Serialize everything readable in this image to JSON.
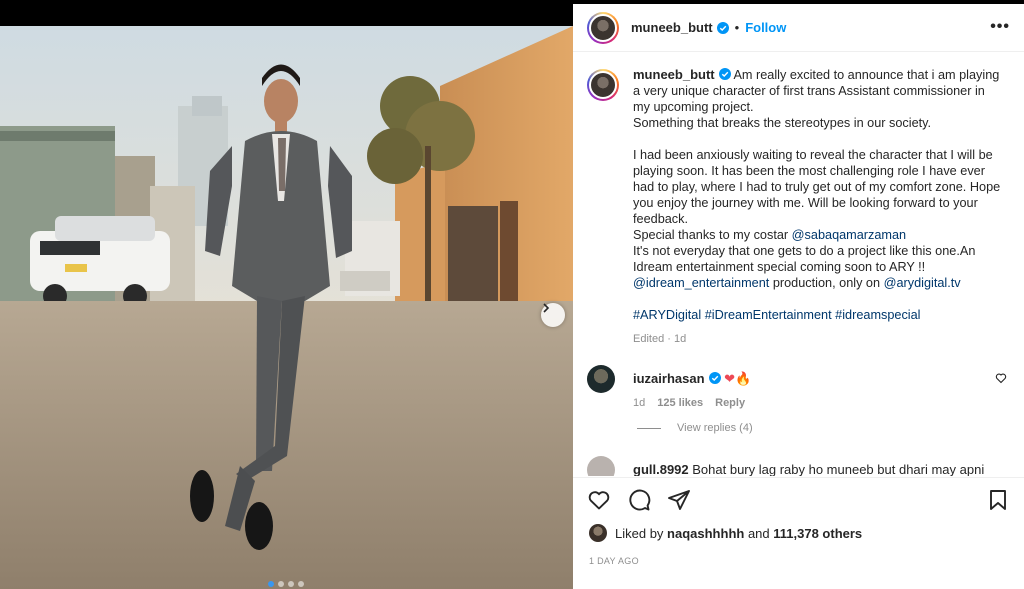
{
  "post": {
    "username": "muneeb_butt",
    "follow_label": "Follow",
    "separator": "•",
    "more_label": "•••",
    "caption_lines": [
      "Am really excited to announce that i am playing a very unique character of first trans Assistant commissioner in my upcoming project.",
      "Something that breaks the stereotypes in our society.",
      "",
      "I had been anxiously waiting to reveal the character that I will be playing soon. It has been the most challenging role I have ever had to play, where I had to truly get out of my comfort zone. Hope you enjoy the journey with me. Will be looking forward to your feedback."
    ],
    "thanks_prefix": "Special thanks to my costar ",
    "costar_mention": "@sabaqamarzaman",
    "line_everyday": "It's not everyday that one gets to do a project like this one.An Idream entertainment special coming soon to ARY !!",
    "mention_idream": "@idream_entertainment",
    "production_text": " production, only on ",
    "mention_ary": "@arydigital.tv",
    "hashtags": [
      "#ARYDigital",
      "#iDreamEntertainment",
      "#idreamspecial"
    ],
    "edited_meta": "Edited · 1d"
  },
  "comments": [
    {
      "username": "iuzairhasan",
      "text_emojis": "❤🔥",
      "age": "1d",
      "likes": "125 likes",
      "reply_label": "Reply",
      "view_replies": "View replies (4)"
    },
    {
      "username": "gull.8992",
      "text": "Bohat bury lag raby ho muneeb but dhari may apni"
    }
  ],
  "likes": {
    "prefix": "Liked by ",
    "user": "naqashhhhh",
    "and": " and ",
    "others": "111,378 others"
  },
  "date": "1 DAY AGO",
  "colors": {
    "accent": "#0095f6",
    "heart": "#ed4956",
    "carousel_active": "#3897f0"
  },
  "carousel": {
    "total": 4,
    "active": 1
  },
  "icons": [
    "verified-badge-icon",
    "heart-icon",
    "comment-icon",
    "share-icon",
    "bookmark-icon",
    "chevron-right-icon",
    "more-options-icon"
  ]
}
